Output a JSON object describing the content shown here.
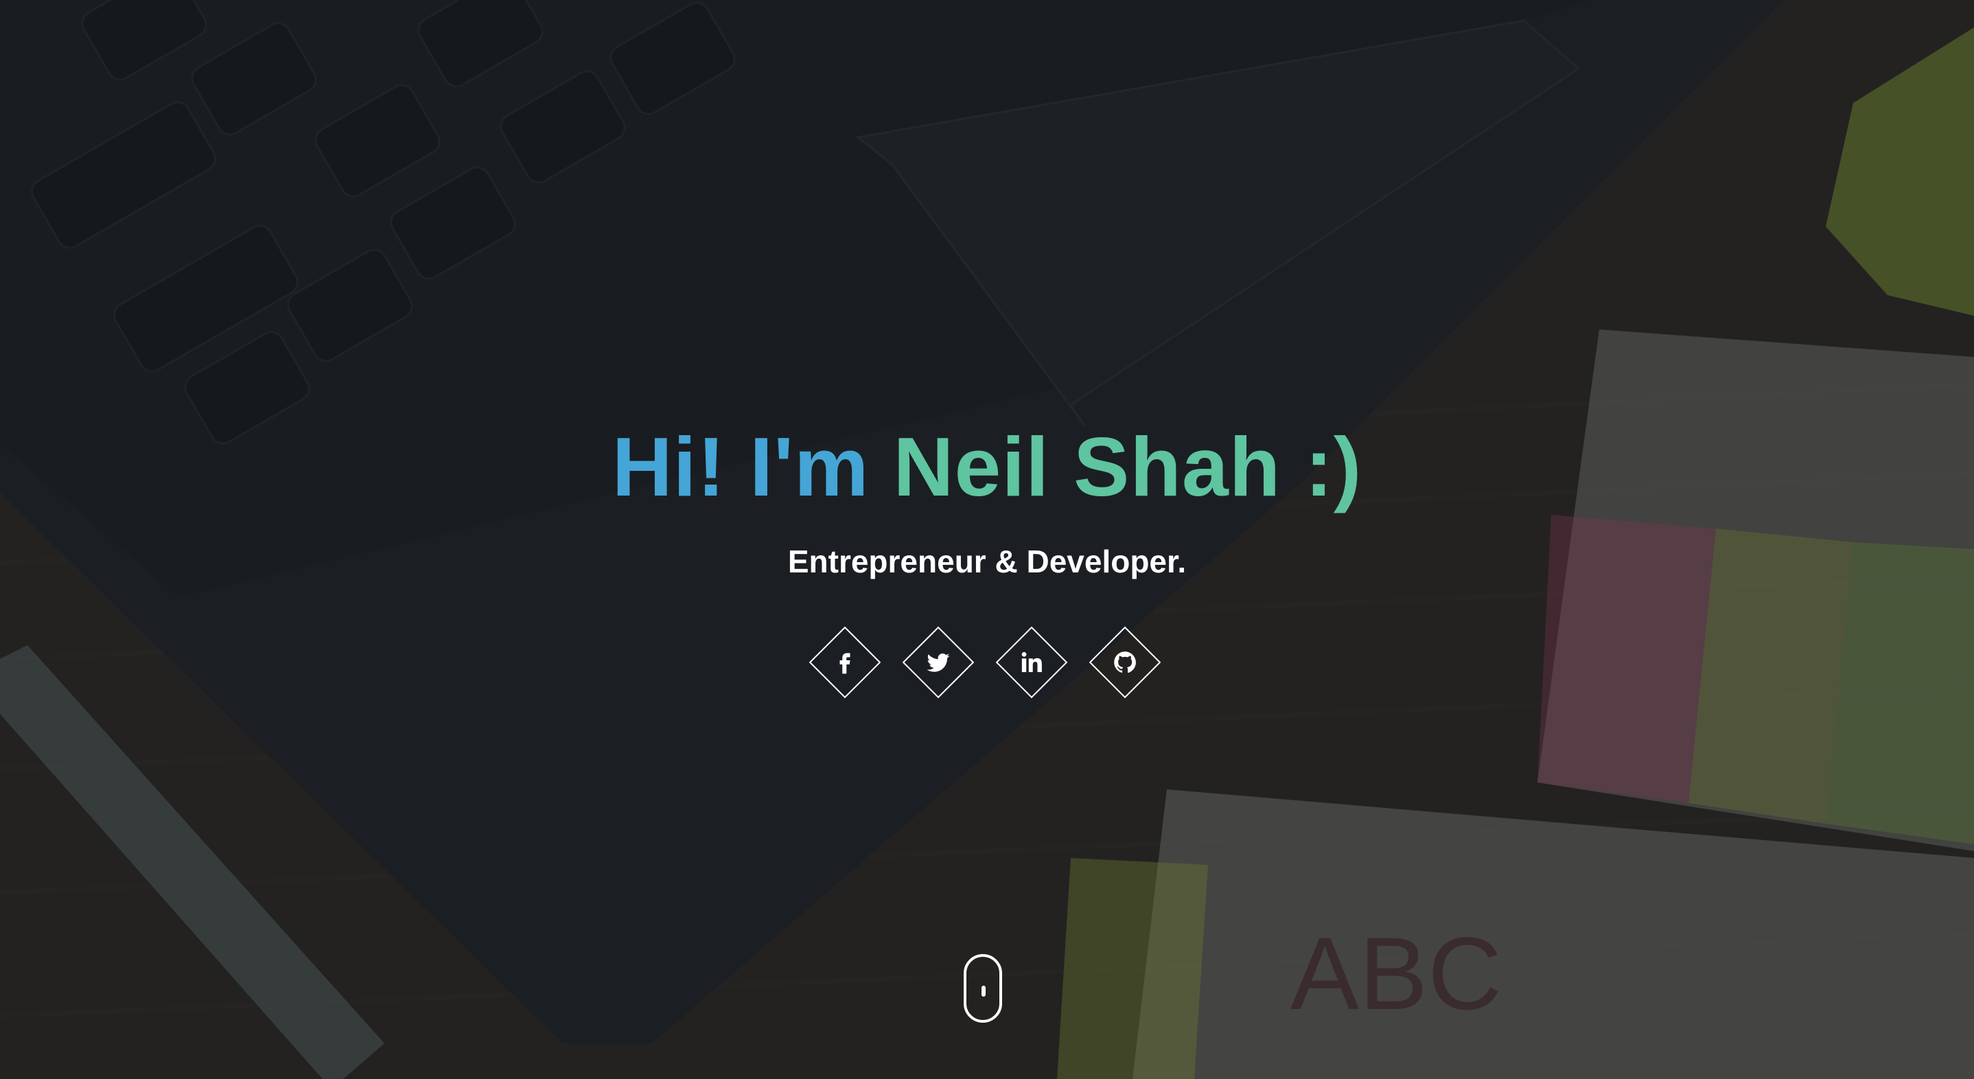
{
  "hero": {
    "title_part1": "Hi! I'm",
    "title_part2": "Neil Shah :)",
    "subtitle": "Entrepreneur & Developer.",
    "title_gradient": [
      "#45a5d6",
      "#5fc4a0"
    ],
    "background_label": "ABC"
  },
  "social_links": [
    {
      "name": "facebook",
      "icon": "facebook-icon"
    },
    {
      "name": "twitter",
      "icon": "twitter-icon"
    },
    {
      "name": "linkedin",
      "icon": "linkedin-icon"
    },
    {
      "name": "github",
      "icon": "github-icon"
    }
  ],
  "scroll_indicator": {
    "icon": "mouse-scroll-icon"
  },
  "colors": {
    "text": "#ffffff",
    "accent_blue": "#45a5d6",
    "accent_green": "#5fc4a0"
  }
}
